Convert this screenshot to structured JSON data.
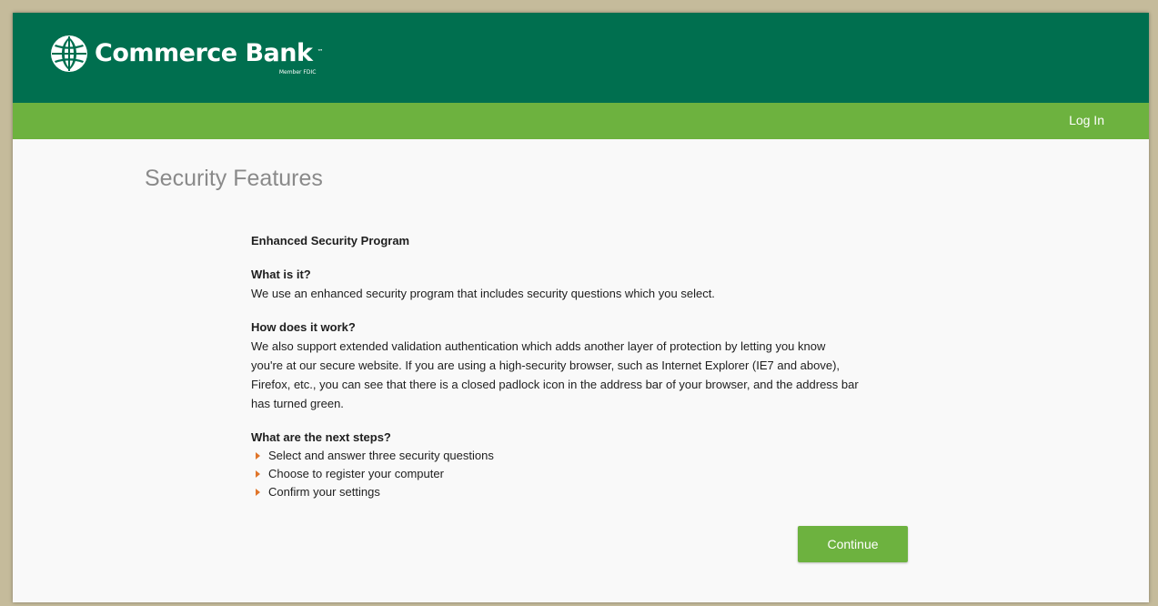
{
  "brand": {
    "name": "Commerce Bank",
    "trademark": "™",
    "member_fdic": "Member FDIC"
  },
  "nav": {
    "login_label": "Log In"
  },
  "page": {
    "title": "Security Features"
  },
  "content": {
    "program_title": "Enhanced Security Program",
    "what_heading": "What is it?",
    "what_text": "We use an enhanced security program that includes security questions which you select.",
    "how_heading": "How does it work?",
    "how_lines": [
      "We also support extended validation authentication which adds another layer of protection by letting you know",
      "you're at our secure website. If you are using a high-security browser, such as Internet Explorer (IE7 and above),",
      "Firefox, etc., you can see that there is a closed padlock icon in the address bar of your browser, and the address bar",
      "has turned green."
    ],
    "next_heading": "What are the next steps?",
    "steps": [
      "Select and answer three security questions",
      "Choose to register your computer",
      "Confirm your settings"
    ]
  },
  "actions": {
    "continue_label": "Continue"
  },
  "colors": {
    "header_green": "#006f4f",
    "nav_green": "#6db23f",
    "button_green": "#6db23f",
    "bullet_orange": "#e0752a",
    "title_gray": "#8a8a8a"
  },
  "icons": {
    "logo": "globe-icon",
    "bullet": "triangle-right-icon"
  }
}
